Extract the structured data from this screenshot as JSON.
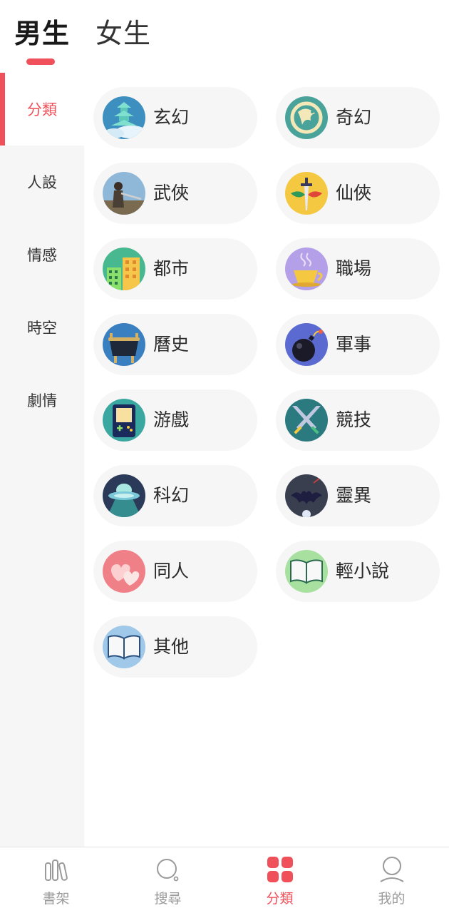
{
  "header": {
    "tabs": [
      {
        "label": "男生",
        "active": true
      },
      {
        "label": "女生",
        "active": false
      }
    ],
    "accent_color": "#f0505a"
  },
  "sidebar": {
    "items": [
      {
        "label": "分類",
        "active": true
      },
      {
        "label": "人設",
        "active": false
      },
      {
        "label": "情感",
        "active": false
      },
      {
        "label": "時空",
        "active": false
      },
      {
        "label": "劇情",
        "active": false
      }
    ]
  },
  "categories": [
    {
      "label": "玄幻",
      "icon": "pagoda-icon"
    },
    {
      "label": "奇幻",
      "icon": "dragon-icon"
    },
    {
      "label": "武俠",
      "icon": "swordsman-icon"
    },
    {
      "label": "仙俠",
      "icon": "sword-icon"
    },
    {
      "label": "都市",
      "icon": "buildings-icon"
    },
    {
      "label": "職場",
      "icon": "coffee-cup-icon"
    },
    {
      "label": "曆史",
      "icon": "cauldron-icon"
    },
    {
      "label": "軍事",
      "icon": "bomb-icon"
    },
    {
      "label": "游戲",
      "icon": "gameboy-icon"
    },
    {
      "label": "競技",
      "icon": "crossed-swords-icon"
    },
    {
      "label": "科幻",
      "icon": "ufo-icon"
    },
    {
      "label": "靈異",
      "icon": "bat-icon"
    },
    {
      "label": "同人",
      "icon": "hearts-icon"
    },
    {
      "label": "輕小說",
      "icon": "open-book-icon"
    },
    {
      "label": "其他",
      "icon": "open-book-icon"
    }
  ],
  "bottom_nav": {
    "items": [
      {
        "label": "書架",
        "icon": "bookshelf-icon",
        "active": false
      },
      {
        "label": "搜尋",
        "icon": "search-icon",
        "active": false
      },
      {
        "label": "分類",
        "icon": "category-grid-icon",
        "active": true
      },
      {
        "label": "我的",
        "icon": "profile-icon",
        "active": false
      }
    ]
  }
}
